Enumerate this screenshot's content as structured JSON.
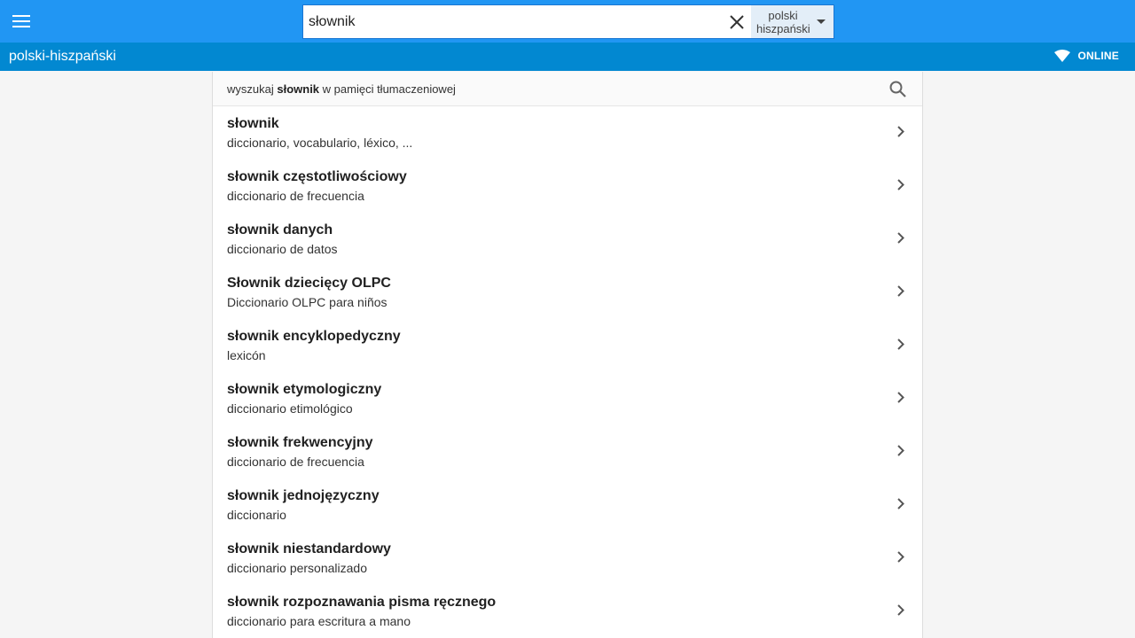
{
  "header": {
    "search": {
      "value": "słownik",
      "placeholder": ""
    },
    "language_select": {
      "line1": "polski",
      "line2": "hiszpański"
    }
  },
  "subheader": {
    "title": "polski-hiszpański",
    "status": "ONLINE"
  },
  "memory_search": {
    "prefix": "wyszukaj ",
    "term": "słownik",
    "suffix": " w pamięci tłumaczeniowej"
  },
  "results": [
    {
      "term": "słownik",
      "translation": "diccionario, vocabulario, léxico, ..."
    },
    {
      "term": "słownik częstotliwościowy",
      "translation": "diccionario de frecuencia"
    },
    {
      "term": "słownik danych",
      "translation": "diccionario de datos"
    },
    {
      "term": "Słownik dziecięcy OLPC",
      "translation": "Diccionario OLPC para niños"
    },
    {
      "term": "słownik encyklopedyczny",
      "translation": "lexicón"
    },
    {
      "term": "słownik etymologiczny",
      "translation": "diccionario etimológico"
    },
    {
      "term": "słownik frekwencyjny",
      "translation": "diccionario de frecuencia"
    },
    {
      "term": "słownik jednojęzyczny",
      "translation": "diccionario"
    },
    {
      "term": "słownik niestandardowy",
      "translation": "diccionario personalizado"
    },
    {
      "term": "słownik rozpoznawania pisma ręcznego",
      "translation": "diccionario para escritura a mano"
    }
  ],
  "icons": {
    "menu": "menu-icon",
    "clear": "close-icon",
    "caret": "caret-down-icon",
    "wifi": "wifi-icon",
    "search": "search-icon",
    "chevron": "chevron-right-icon"
  },
  "colors": {
    "topbar": "#2196f3",
    "subbar": "#0288d1",
    "background": "#f5f5f5"
  }
}
